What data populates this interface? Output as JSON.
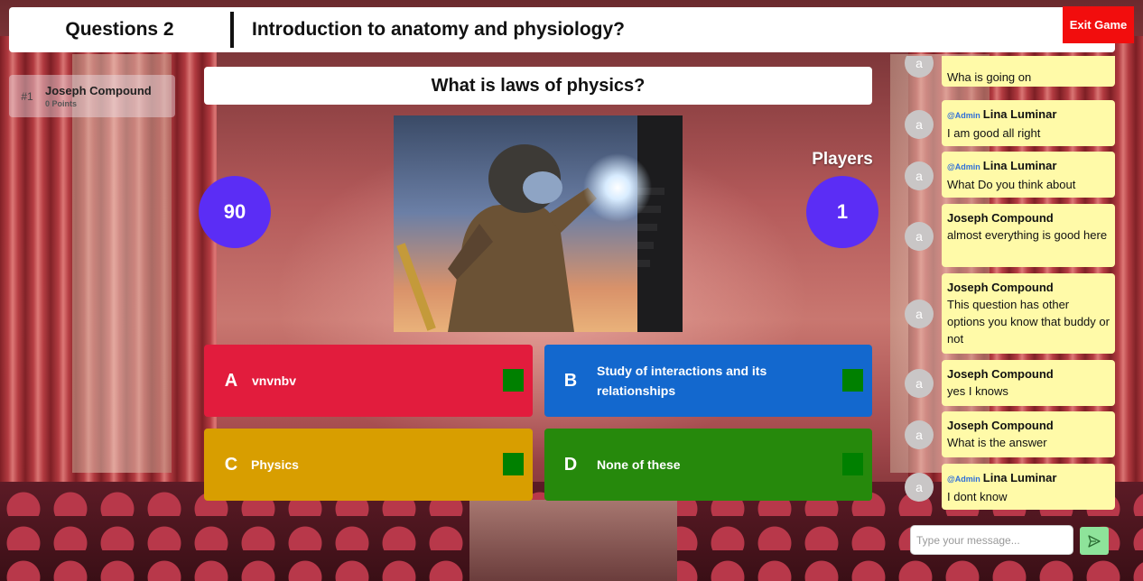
{
  "header": {
    "question_number": "Questions 2",
    "topic": "Introduction to anatomy and physiology?",
    "exit_label": "Exit Game"
  },
  "leaderboard": [
    {
      "rank": "#1",
      "name": "Joseph Compound",
      "points": "0 Points"
    }
  ],
  "question": {
    "text": "What is laws of physics?"
  },
  "timer": "90",
  "players": {
    "label": "Players",
    "count": "1"
  },
  "answers": [
    {
      "letter": "A",
      "text": "vnvnbv",
      "color": "#e21c3d"
    },
    {
      "letter": "B",
      "text": "Study of interactions and its relationships",
      "color": "#1368ce"
    },
    {
      "letter": "C",
      "text": "Physics",
      "color": "#d89e00"
    },
    {
      "letter": "D",
      "text": "None of these",
      "color": "#26890c"
    }
  ],
  "chat": {
    "messages": [
      {
        "avatar": "a",
        "admin": "",
        "sender": "",
        "text": "Wha is going on"
      },
      {
        "avatar": "a",
        "admin": "@Admin",
        "sender": "Lina Luminar",
        "text": "I am good all right"
      },
      {
        "avatar": "a",
        "admin": "@Admin",
        "sender": "Lina Luminar",
        "text": "What Do you think about"
      },
      {
        "avatar": "a",
        "admin": "",
        "sender": "Joseph Compound",
        "text": "almost everything is good here"
      },
      {
        "avatar": "a",
        "admin": "",
        "sender": "Joseph Compound",
        "text": "This question has other options you know that buddy or not"
      },
      {
        "avatar": "a",
        "admin": "",
        "sender": "Joseph Compound",
        "text": "yes I knows"
      },
      {
        "avatar": "a",
        "admin": "",
        "sender": "Joseph Compound",
        "text": "What is the answer"
      },
      {
        "avatar": "a",
        "admin": "@Admin",
        "sender": "Lina Luminar",
        "text": "I dont know"
      }
    ],
    "input_placeholder": "Type your message..."
  }
}
